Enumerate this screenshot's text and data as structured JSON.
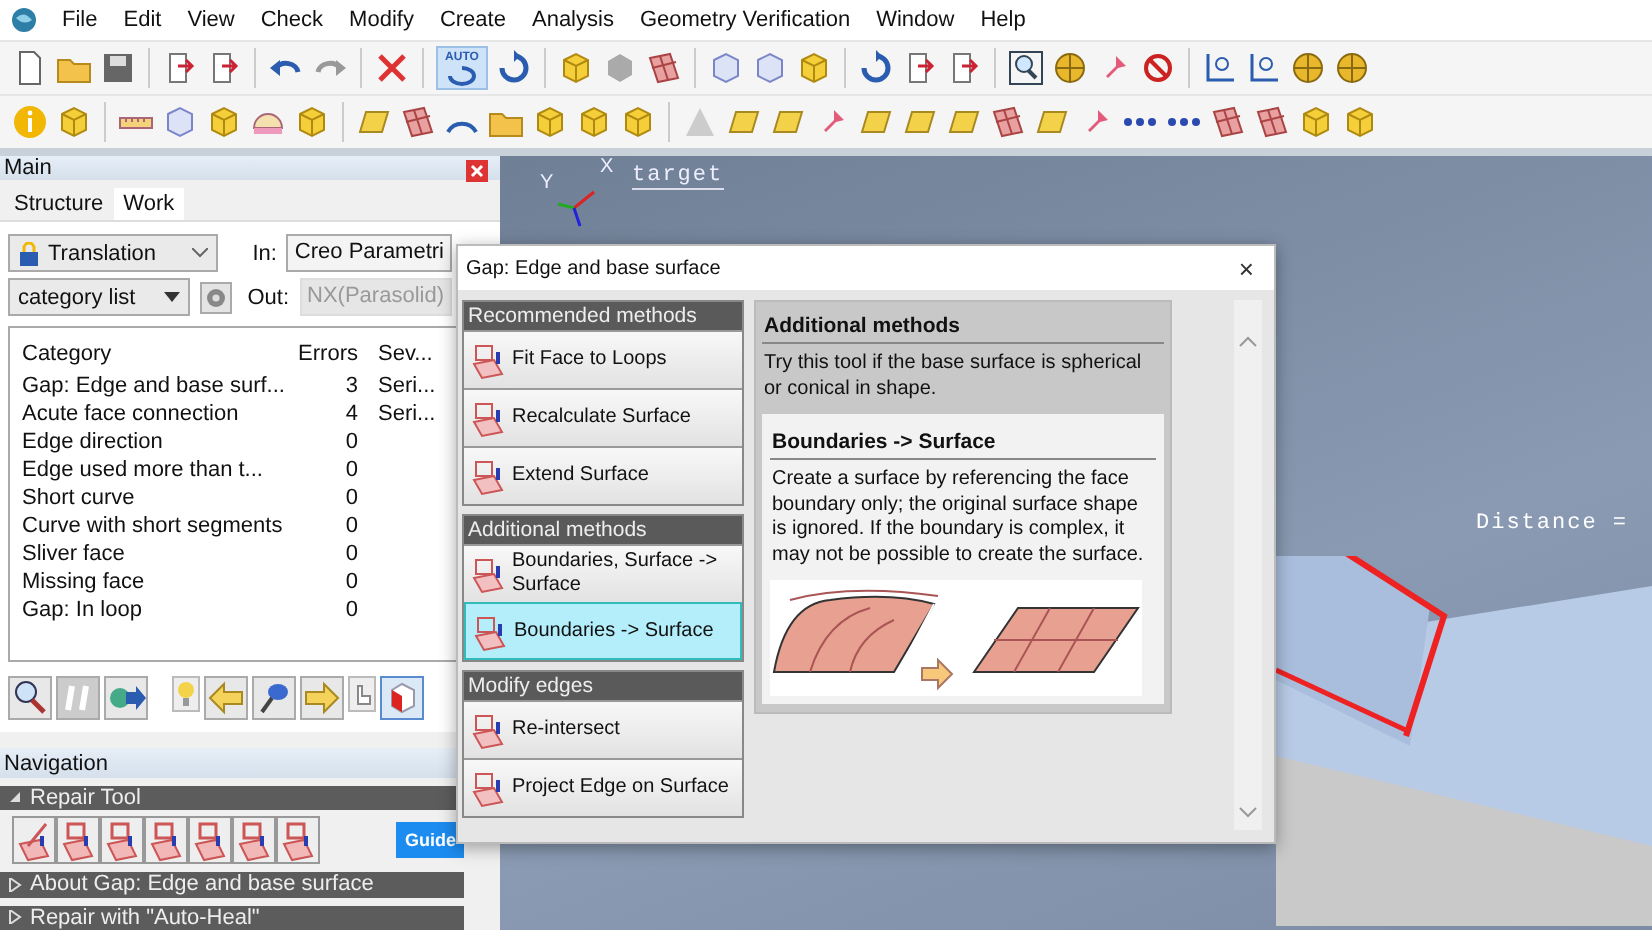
{
  "menu": [
    {
      "label": "File"
    },
    {
      "label": "Edit"
    },
    {
      "label": "View"
    },
    {
      "label": "Check"
    },
    {
      "label": "Modify"
    },
    {
      "label": "Create"
    },
    {
      "label": "Analysis"
    },
    {
      "label": "Geometry Verification"
    },
    {
      "label": "Window"
    },
    {
      "label": "Help"
    }
  ],
  "toolbar": {
    "auto_label": "AUTO"
  },
  "main_panel": {
    "title": "Main",
    "tabs": [
      {
        "label": "Structure",
        "selected": false
      },
      {
        "label": "Work",
        "selected": true
      }
    ],
    "mode": "Translation",
    "in_label": "In:",
    "in_value": "Creo Parametri",
    "list_select": "category list",
    "out_label": "Out:",
    "out_value": "NX(Parasolid)",
    "out_disabled": true,
    "table": {
      "columns": [
        "Category",
        "Errors",
        "Sev..."
      ],
      "rows": [
        [
          "Gap: Edge and base surf...",
          "3",
          "Seri..."
        ],
        [
          "Acute face connection",
          "4",
          "Seri..."
        ],
        [
          "Edge direction",
          "0",
          ""
        ],
        [
          "Edge used more than t...",
          "0",
          ""
        ],
        [
          "Short curve",
          "0",
          ""
        ],
        [
          "Curve with short segments",
          "0",
          ""
        ],
        [
          "Sliver face",
          "0",
          ""
        ],
        [
          "Missing face",
          "0",
          ""
        ],
        [
          "Gap: In loop",
          "0",
          ""
        ]
      ]
    }
  },
  "navigation": {
    "title": "Navigation",
    "guide_button": "Guide",
    "sections": [
      {
        "title": "Repair Tool",
        "expanded": true
      },
      {
        "title": "About Gap: Edge and base surface",
        "expanded": false
      },
      {
        "title": "Repair with \"Auto-Heal\"",
        "expanded": false
      }
    ]
  },
  "viewport": {
    "axis_x": "X",
    "axis_y": "Y",
    "label_target": "target",
    "label_distance": "Distance ="
  },
  "dialog": {
    "title": "Gap: Edge and base surface",
    "close": "×",
    "groups": [
      {
        "title": "Recommended methods",
        "methods": [
          {
            "label": "Fit Face to Loops",
            "selected": false
          },
          {
            "label": "Recalculate Surface",
            "selected": false
          },
          {
            "label": "Extend Surface",
            "selected": false
          }
        ]
      },
      {
        "title": "Additional methods",
        "methods": [
          {
            "label": "Boundaries, Surface -> Surface",
            "selected": false
          },
          {
            "label": "Boundaries -> Surface",
            "selected": true
          }
        ]
      },
      {
        "title": "Modify edges",
        "methods": [
          {
            "label": "Re-intersect",
            "selected": false
          },
          {
            "label": "Project Edge on Surface",
            "selected": false
          }
        ]
      }
    ],
    "info": {
      "heading": "Additional methods",
      "text": "Try this tool if the base surface is spherical or conical in shape.",
      "card_heading": "Boundaries -> Surface",
      "card_text": "Create a surface by referencing the face boundary only; the original surface shape is ignored.  If the boundary is complex, it may not be possible to create the surface."
    }
  }
}
